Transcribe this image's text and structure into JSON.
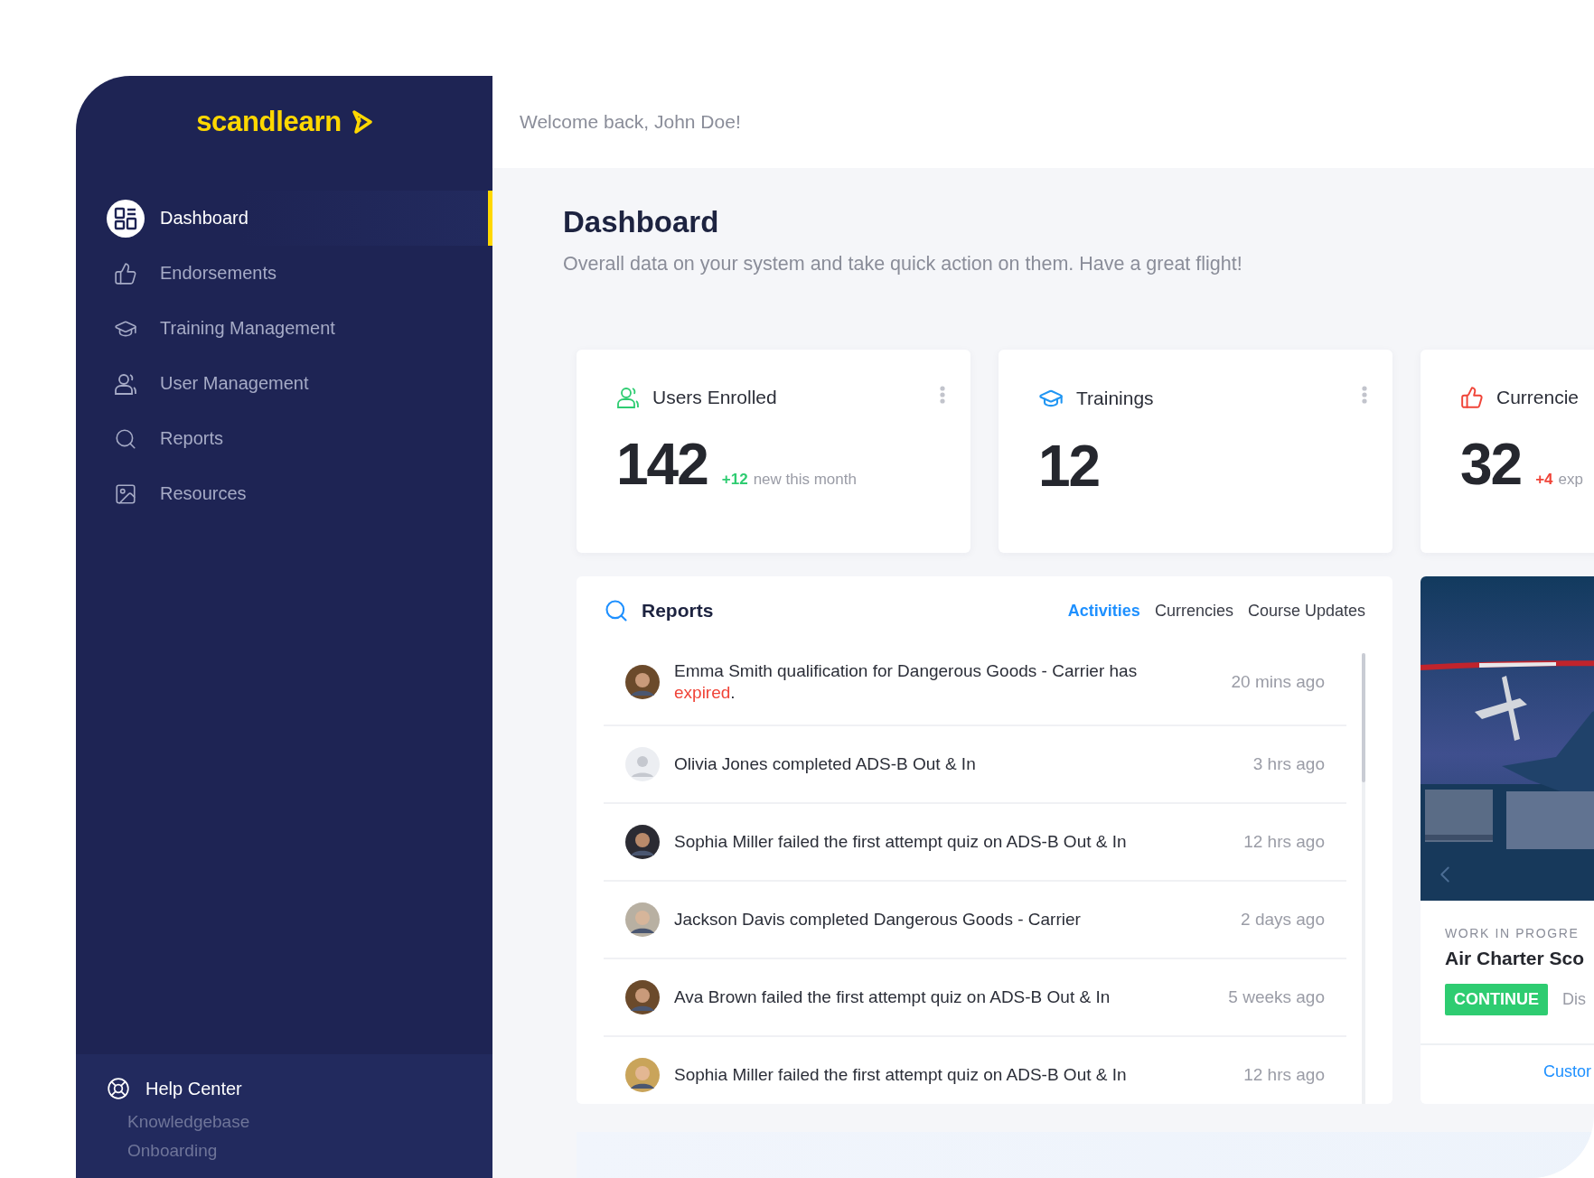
{
  "sidebar": {
    "logo": "scandlearn",
    "nav": [
      {
        "label": "Dashboard",
        "selected": true
      },
      {
        "label": "Endorsements",
        "selected": false
      },
      {
        "label": "Training Management",
        "selected": false
      },
      {
        "label": "User Management",
        "selected": false
      },
      {
        "label": "Reports",
        "selected": false
      },
      {
        "label": "Resources",
        "selected": false
      }
    ],
    "help": {
      "title": "Help Center",
      "links": [
        "Knowledgebase",
        "Onboarding"
      ]
    }
  },
  "header": {
    "greeting": "Welcome back, John Doe!"
  },
  "page": {
    "title": "Dashboard",
    "subtitle": "Overall data on your system and take quick action on them. Have a great flight!"
  },
  "stats": [
    {
      "title": "Users Enrolled",
      "value": "142",
      "delta": "+12",
      "note": "new this month",
      "color": "#2ecc71",
      "menu": true
    },
    {
      "title": "Trainings",
      "value": "12",
      "color": "#2196f3",
      "menu": true
    },
    {
      "title": "Currencie",
      "value": "32",
      "delta": "+4",
      "note": "exp",
      "color": "#f04438",
      "menu": false
    }
  ],
  "reports": {
    "title": "Reports",
    "tabs": [
      {
        "label": "Activities",
        "selected": true
      },
      {
        "label": "Currencies",
        "selected": false
      },
      {
        "label": "Course Updates",
        "selected": false
      }
    ],
    "items": [
      {
        "text": "Emma Smith qualification for Dangerous Goods - Carrier has",
        "highlight": "expired",
        "suffix": ".",
        "time": "20 mins ago"
      },
      {
        "kind": "placeholder",
        "text": "Olivia Jones completed ADS-B Out & In",
        "time": "3 hrs ago"
      },
      {
        "text": "Sophia Miller failed the first attempt quiz on ADS-B Out & In",
        "time": "12 hrs ago"
      },
      {
        "text": "Jackson Davis completed Dangerous Goods - Carrier",
        "time": "2 days ago"
      },
      {
        "text": "Ava Brown failed the first attempt quiz on ADS-B Out & In",
        "time": "5 weeks ago"
      },
      {
        "text": "Sophia Miller failed the first attempt quiz on ADS-B Out & In",
        "time": "12 hrs ago"
      }
    ]
  },
  "feature": {
    "label": "WORK IN PROGRE",
    "title": "Air Charter Sco",
    "action": "CONTINUE",
    "secondary": "Dis",
    "link": "Custor"
  }
}
